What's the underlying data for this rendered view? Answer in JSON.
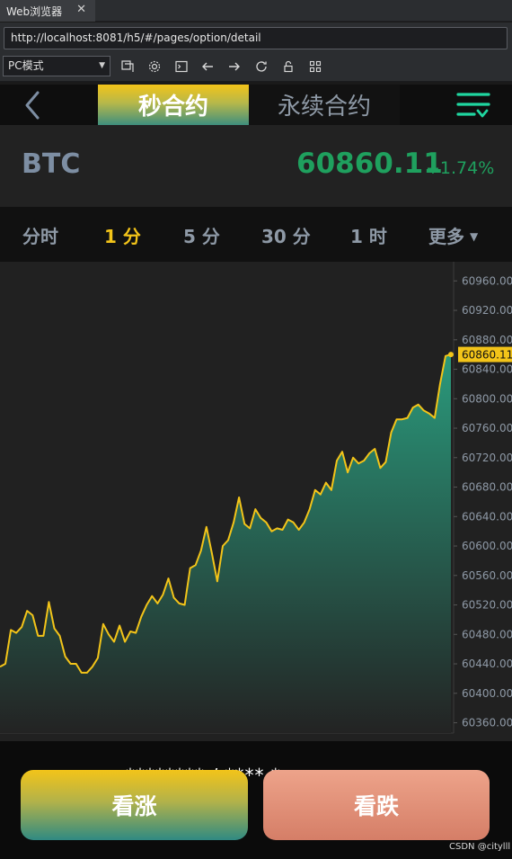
{
  "browser": {
    "tab_title": "Web浏览器",
    "tab_close": "✕",
    "url": "http://localhost:8081/h5/#/pages/option/detail",
    "mode": "PC模式",
    "toolbar_icons": [
      "screenshot-icon",
      "settings-icon",
      "terminal-icon",
      "back-arrow-icon",
      "forward-arrow-icon",
      "refresh-icon",
      "lock-icon",
      "qrcode-icon"
    ]
  },
  "header": {
    "tabs": [
      "秒合约",
      "永续合约"
    ],
    "active_tab": 0
  },
  "ticker": {
    "symbol": "BTC",
    "price": "60860.11",
    "change": "+1.74%",
    "color_up": "#1fa05e"
  },
  "intervals": {
    "items": [
      "分时",
      "1 分",
      "5 分",
      "30 分",
      "1 时",
      "更多"
    ],
    "active": 1
  },
  "chart_data": {
    "type": "area",
    "y_ticks": [
      "60960.00",
      "60920.00",
      "60880.00",
      "60840.00",
      "60800.00",
      "60760.00",
      "60720.00",
      "60680.00",
      "60640.00",
      "60600.00",
      "60560.00",
      "60520.00",
      "60480.00",
      "60400.00",
      "60440.00",
      "60360.00"
    ],
    "y_tick_values": [
      60960,
      60920,
      60880,
      60840,
      60800,
      60760,
      60720,
      60680,
      60640,
      60600,
      60560,
      60520,
      60480,
      60440,
      60400,
      60360
    ],
    "ylim": [
      60346,
      60986
    ],
    "last_price_label": "60860.11",
    "line_color": "#f3c419",
    "fill_top": "#2a9a7c",
    "values": [
      60436,
      60440,
      60486,
      60482,
      60490,
      60512,
      60506,
      60478,
      60478,
      60524,
      60488,
      60478,
      60450,
      60440,
      60440,
      60428,
      60428,
      60436,
      60448,
      60494,
      60480,
      60470,
      60492,
      60470,
      60484,
      60482,
      60504,
      60520,
      60532,
      60522,
      60534,
      60556,
      60530,
      60522,
      60520,
      60570,
      60574,
      60594,
      60626,
      60590,
      60552,
      60600,
      60608,
      60632,
      60666,
      60630,
      60624,
      60650,
      60638,
      60632,
      60620,
      60624,
      60622,
      60636,
      60632,
      60622,
      60632,
      60650,
      60676,
      60670,
      60686,
      60676,
      60716,
      60728,
      60700,
      60720,
      60712,
      60716,
      60726,
      60732,
      60706,
      60714,
      60754,
      60772,
      60772,
      60774,
      60788,
      60792,
      60784,
      60780,
      60774,
      60820,
      60858,
      60860.11
    ]
  },
  "actions": {
    "up_label": "看涨",
    "down_label": "看跌",
    "obscured_text": "********  /  ****  *"
  },
  "watermark": "CSDN @citylll"
}
